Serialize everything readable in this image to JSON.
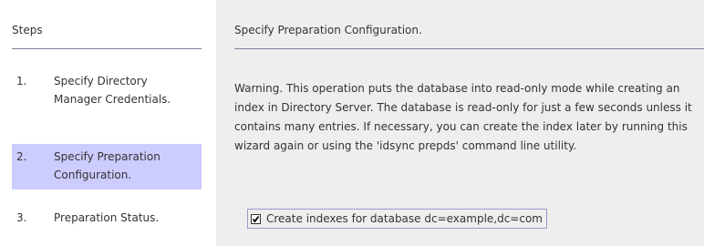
{
  "steps_panel": {
    "title": "Steps",
    "items": [
      {
        "number": "1.",
        "label": "Specify Directory Manager Credentials.",
        "selected": false
      },
      {
        "number": "2.",
        "label": "Specify Preparation Configuration.",
        "selected": true
      },
      {
        "number": "3.",
        "label": "Preparation Status.",
        "selected": false
      }
    ]
  },
  "content": {
    "title": "Specify Preparation Configuration.",
    "warning": "Warning. This operation puts the database into read-only mode while creating an index in Directory Server. The database is read-only for just a few seconds unless it contains many entries. If necessary, you can create the index later by running this wizard again or using the 'idsync prepds' command line utility.",
    "checkbox": {
      "label": "Create indexes for database dc=example,dc=com",
      "checked": true
    }
  },
  "colors": {
    "selected_step_bg": "#ccccff",
    "content_bg": "#eeeeee",
    "divider": "#7f7f99"
  }
}
